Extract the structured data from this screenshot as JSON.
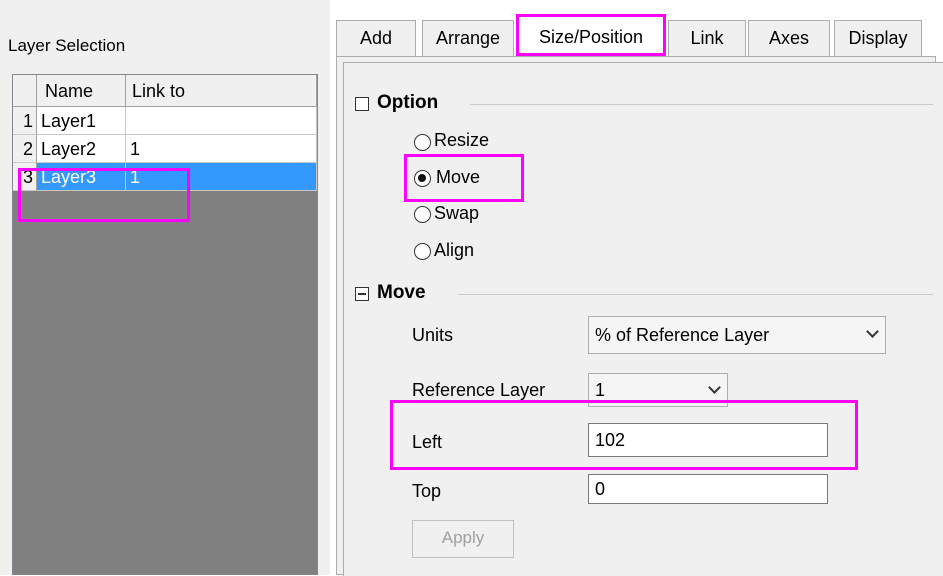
{
  "layer_panel": {
    "title": "Layer Selection",
    "columns": [
      "Name",
      "Link to"
    ],
    "rows": [
      {
        "num": "1",
        "name": "Layer1",
        "link": ""
      },
      {
        "num": "2",
        "name": "Layer2",
        "link": "1"
      },
      {
        "num": "3",
        "name": "Layer3",
        "link": "1"
      }
    ],
    "selected_row": 3
  },
  "tabs": [
    "Add",
    "Arrange",
    "Size/Position",
    "Link",
    "Axes",
    "Display"
  ],
  "active_tab": "Size/Position",
  "option_group": {
    "title": "Option",
    "radios": [
      {
        "label": "Resize",
        "checked": false
      },
      {
        "label": "Move",
        "checked": true
      },
      {
        "label": "Swap",
        "checked": false
      },
      {
        "label": "Align",
        "checked": false
      }
    ]
  },
  "move_group": {
    "title": "Move",
    "units_label": "Units",
    "units_value": "% of Reference Layer",
    "reference_label": "Reference Layer",
    "reference_value": "1",
    "left_label": "Left",
    "left_value": "102",
    "top_label": "Top",
    "top_value": "0",
    "apply_label": "Apply"
  },
  "colors": {
    "highlight": "#ff00ff",
    "selection": "#3399ff"
  }
}
